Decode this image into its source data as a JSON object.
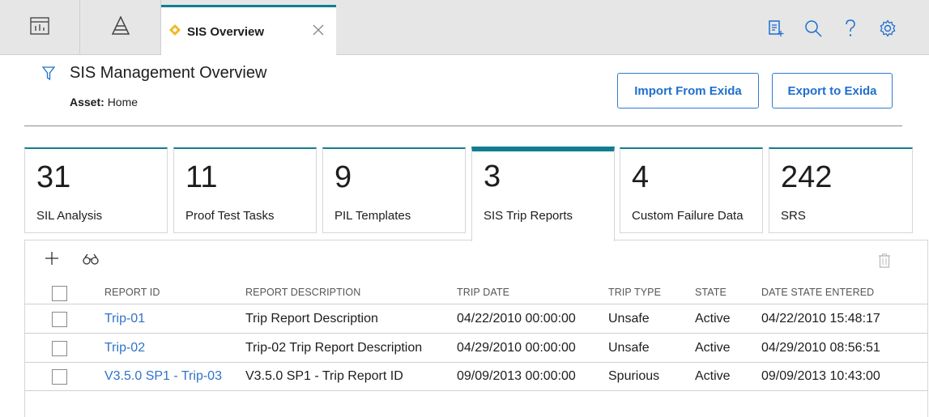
{
  "tabs": {
    "active_label": "SIS Overview"
  },
  "header": {
    "title": "SIS Management Overview",
    "asset_label": "Asset:",
    "asset_value": "Home",
    "import_button": "Import From Exida",
    "export_button": "Export to Exida"
  },
  "tiles": [
    {
      "count": "31",
      "label": "SIL Analysis"
    },
    {
      "count": "11",
      "label": "Proof Test Tasks"
    },
    {
      "count": "9",
      "label": "PIL Templates"
    },
    {
      "count": "3",
      "label": "SIS Trip Reports"
    },
    {
      "count": "4",
      "label": "Custom Failure Data"
    },
    {
      "count": "242",
      "label": "SRS"
    }
  ],
  "grid": {
    "columns": [
      "REPORT ID",
      "REPORT DESCRIPTION",
      "TRIP DATE",
      "TRIP TYPE",
      "STATE",
      "DATE STATE ENTERED"
    ],
    "rows": [
      {
        "id": "Trip-01",
        "description": "Trip Report Description",
        "trip_date": "04/22/2010 00:00:00",
        "trip_type": "Unsafe",
        "state": "Active",
        "state_entered": "04/22/2010 15:48:17"
      },
      {
        "id": "Trip-02",
        "description": "Trip-02 Trip Report Description",
        "trip_date": "04/29/2010 00:00:00",
        "trip_type": "Unsafe",
        "state": "Active",
        "state_entered": "04/29/2010 08:56:51"
      },
      {
        "id": "V3.5.0 SP1 - Trip-03",
        "description": "V3.5.0 SP1 - Trip Report ID",
        "trip_date": "09/09/2013 00:00:00",
        "trip_type": "Spurious",
        "state": "Active",
        "state_entered": "09/09/2013 10:43:00"
      }
    ]
  },
  "colors": {
    "accent": "#117d91",
    "link": "#2f73c9",
    "button": "#1f6fcf",
    "tab_icon": "#f2b829"
  },
  "icons": [
    "dashboard-icon",
    "asset-hierarchy-icon",
    "sis-overview-tab-icon",
    "close-icon",
    "add-task-icon",
    "search-icon",
    "help-icon",
    "settings-icon",
    "filter-icon",
    "add-icon",
    "find-icon",
    "delete-icon"
  ]
}
